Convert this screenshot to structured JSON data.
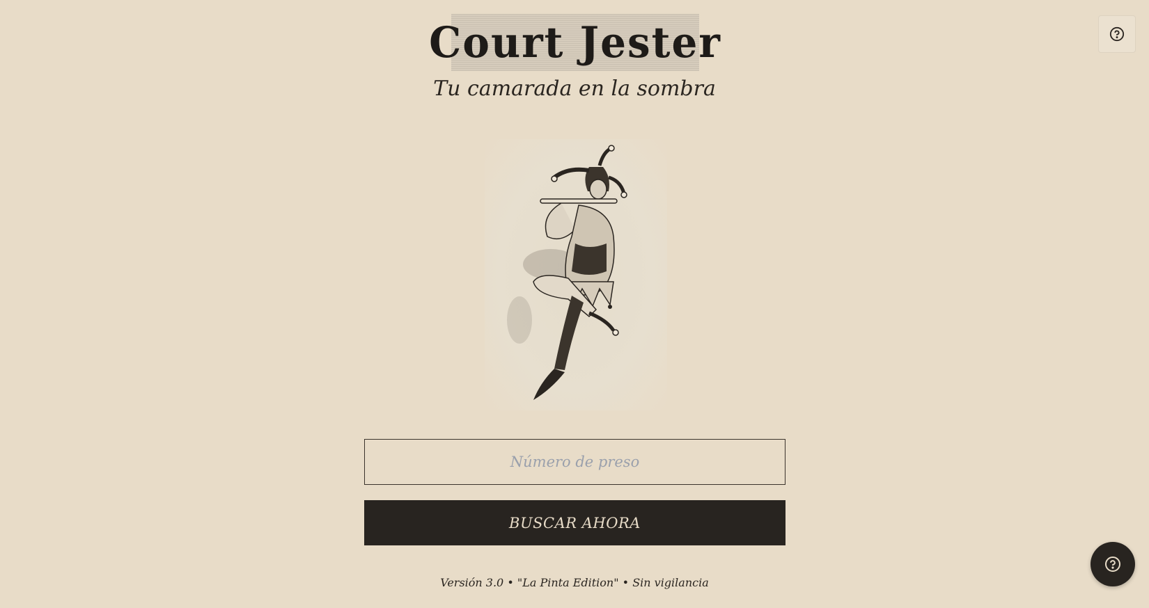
{
  "header": {
    "logo_text": "Court Jester",
    "subtitle": "Tu camarada en la sombra"
  },
  "illustration": {
    "icon": "jester-illustration"
  },
  "search": {
    "placeholder": "Número de preso",
    "value": "",
    "button_label": "BUSCAR AHORA"
  },
  "footer": {
    "text": "Versión 3.0 • \"La Pinta Edition\" • Sin vigilancia"
  },
  "help": {
    "top_icon": "help-circle-icon",
    "fab_icon": "help-circle-icon"
  },
  "colors": {
    "background": "#e8dcc8",
    "ink": "#282420",
    "placeholder": "#9aa0ac"
  }
}
